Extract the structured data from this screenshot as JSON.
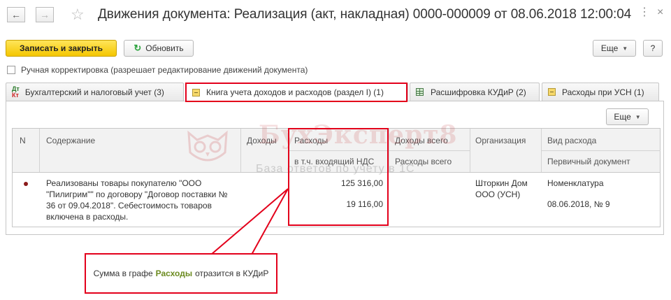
{
  "window": {
    "title": "Движения документа: Реализация (акт, накладная) 0000-000009 от 08.06.2018 12:00:04",
    "back_icon": "arrow-left-icon",
    "forward_icon": "arrow-right-icon",
    "favorite_icon": "star-icon",
    "more_icon": "more-vertical-icon",
    "close_icon": "close-icon"
  },
  "toolbar": {
    "save_close_label": "Записать и закрыть",
    "refresh_label": "Обновить",
    "more_label": "Еще",
    "help_label": "?"
  },
  "manual_edit": {
    "checked": false,
    "label": "Ручная корректировка (разрешает редактирование движений документа)"
  },
  "tabs": [
    {
      "label": "Бухгалтерский и налоговый учет (3)",
      "icon": "dt-kt-icon",
      "active": false
    },
    {
      "label": "Книга учета доходов и расходов (раздел I) (1)",
      "icon": "book-icon",
      "active": true
    },
    {
      "label": "Расшифровка КУДиР (2)",
      "icon": "table-icon",
      "active": false
    },
    {
      "label": "Расходы при УСН (1)",
      "icon": "book-icon",
      "active": false
    }
  ],
  "panel": {
    "more_label": "Еще"
  },
  "table": {
    "headers": {
      "n": "N",
      "content": "Содержание",
      "income": "Доходы",
      "expenses": "Расходы",
      "expenses_vat": "в т.ч. входящий НДС",
      "income_total": "Доходы всего",
      "expenses_total": "Расходы всего",
      "organization": "Организация",
      "expense_type": "Вид расхода",
      "primary_doc": "Первичный документ"
    },
    "rows": [
      {
        "content": "Реализованы товары покупателю \"ООО \"Пилигрим\"\" по договору \"Договор поставки № 36 от 09.04.2018\". Себестоимость товаров включена в расходы.",
        "expenses": "125 316,00",
        "expenses_vat": "19 116,00",
        "organization": "Шторкин Дом ООО (УСН)",
        "expense_type": "Номенклатура",
        "primary_doc": "08.06.2018, № 9"
      }
    ]
  },
  "watermark": {
    "title": "БухЭксперт8",
    "subtitle": "База ответов по учету в 1С"
  },
  "callout": {
    "text_before": "Сумма в графе",
    "highlight": "Расходы",
    "text_after": "отразится в КУДиР"
  },
  "colors": {
    "accent_red": "#e3001b",
    "primary_button": "#f4c600",
    "highlight_text": "#6b8a1f",
    "row_bullet": "#8b1a1a"
  }
}
